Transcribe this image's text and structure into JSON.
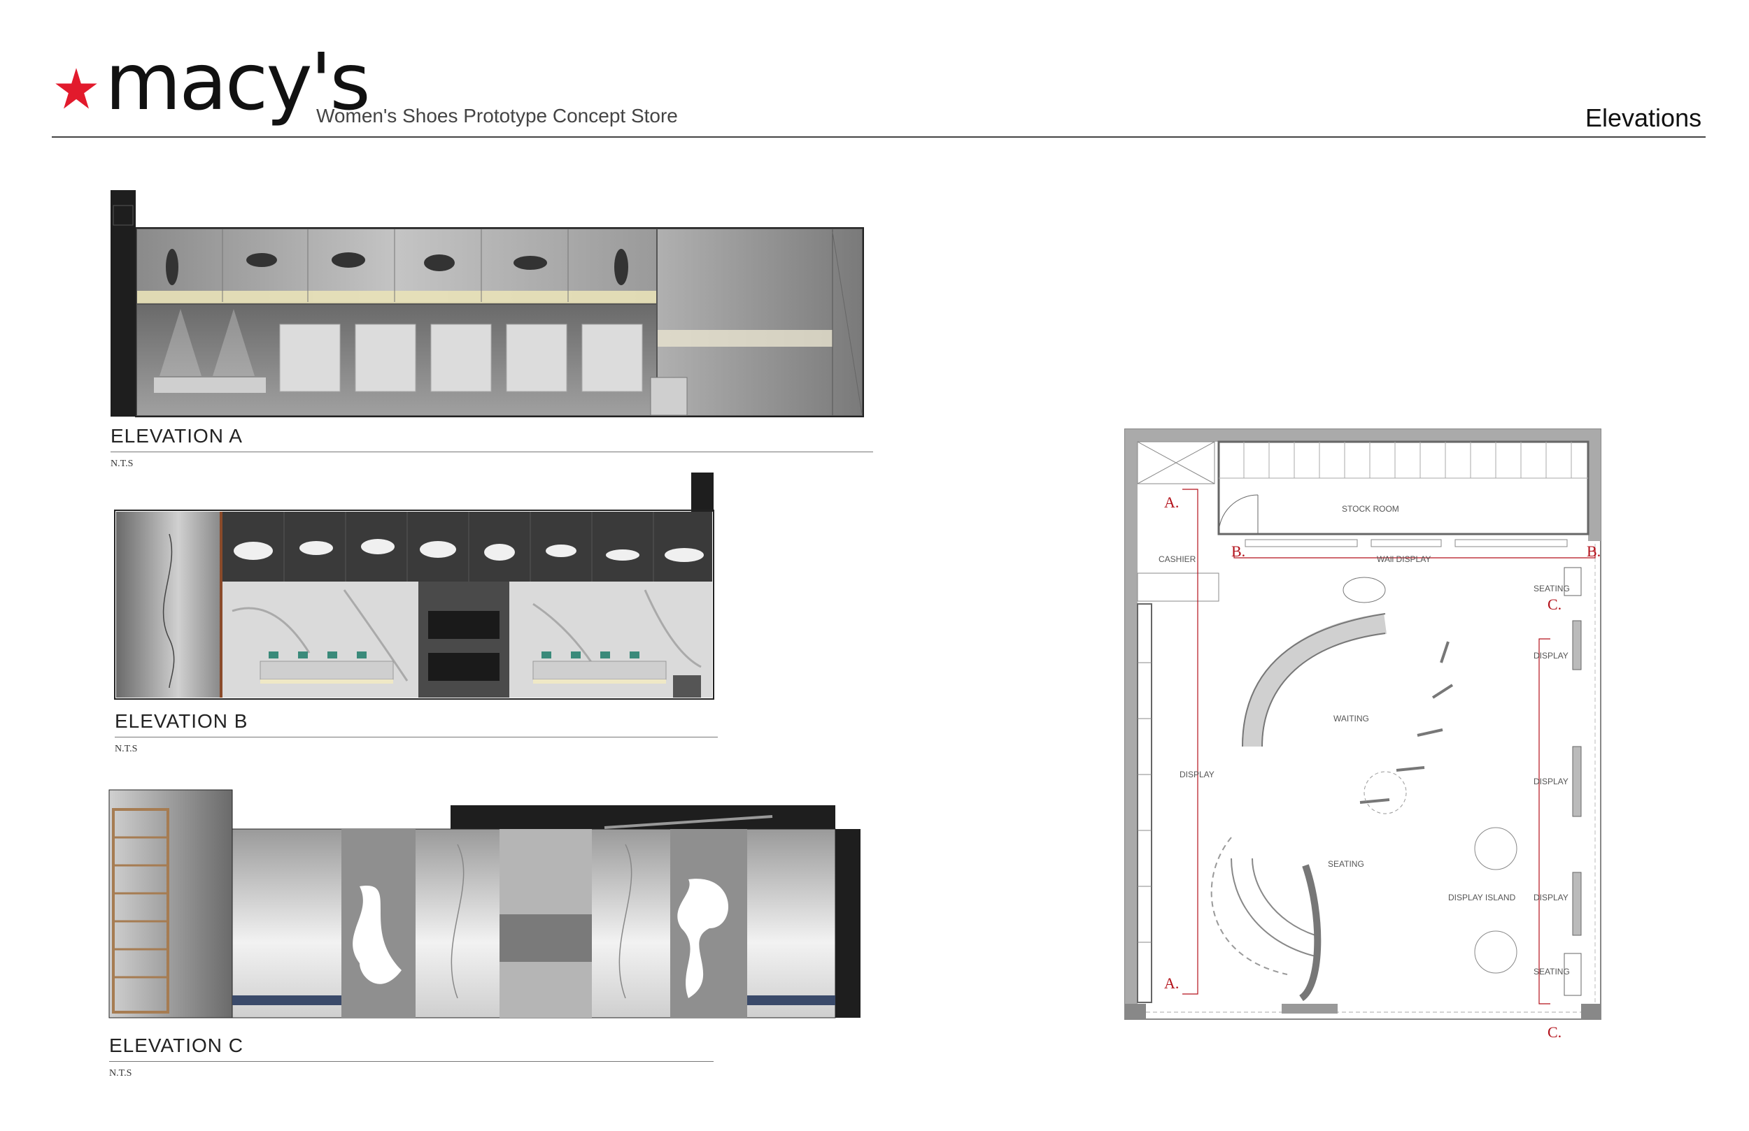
{
  "header": {
    "brand": "macy's",
    "subtitle": "Women's Shoes Prototype Concept Store",
    "section_title": "Elevations",
    "brand_color": "#e21a2c"
  },
  "elevations": [
    {
      "title": "ELEVATION  A",
      "scale": "N.T.S"
    },
    {
      "title": "ELEVATION  B",
      "scale": "N.T.S"
    },
    {
      "title": "ELEVATION  C",
      "scale": "N.T.S"
    }
  ],
  "plan": {
    "rooms": {
      "stock_room": "STOCK ROOM",
      "wall_display": "WAll DISPLAY",
      "cashier": "CASHIER",
      "display_left": "DISPLAY",
      "waiting": "WAITING",
      "seating_center": "SEATING",
      "display_island": "DISPLAY ISLAND",
      "seating_right_top": "SEATING",
      "display_right_1": "DISPLAY",
      "display_right_2": "DISPLAY",
      "display_right_3": "DISPLAY",
      "seating_right_bottom": "SEATING"
    },
    "markers": {
      "a_top": "A.",
      "a_bottom": "A.",
      "b_left": "B.",
      "b_right": "B.",
      "c_top": "C.",
      "c_bottom": "C."
    },
    "marker_color": "#b3121b"
  }
}
